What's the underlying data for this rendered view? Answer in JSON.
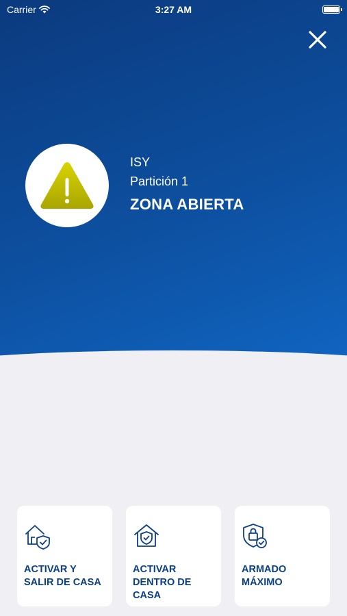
{
  "status_bar": {
    "carrier": "Carrier",
    "time": "3:27 AM",
    "wifi_icon": "wifi-icon",
    "battery_icon": "battery-icon"
  },
  "header": {
    "close_icon": "close-icon"
  },
  "alert": {
    "icon": "warning-icon",
    "system_name": "ISY",
    "partition": "Partición 1",
    "status": "ZONA ABIERTA"
  },
  "actions": [
    {
      "icon": "house-shield-icon",
      "label": "ACTIVAR Y SALIR DE CASA"
    },
    {
      "icon": "house-shield-inside-icon",
      "label": "ACTIVAR DENTRO DE CASA"
    },
    {
      "icon": "lock-shield-icon",
      "label": "ARMADO MÁXIMO"
    }
  ],
  "colors": {
    "brand_blue": "#0b3a7e",
    "brand_blue_light": "#1065c2",
    "warning_yellow": "#c8c400",
    "label_blue": "#0b3f86",
    "background": "#efeff4"
  }
}
